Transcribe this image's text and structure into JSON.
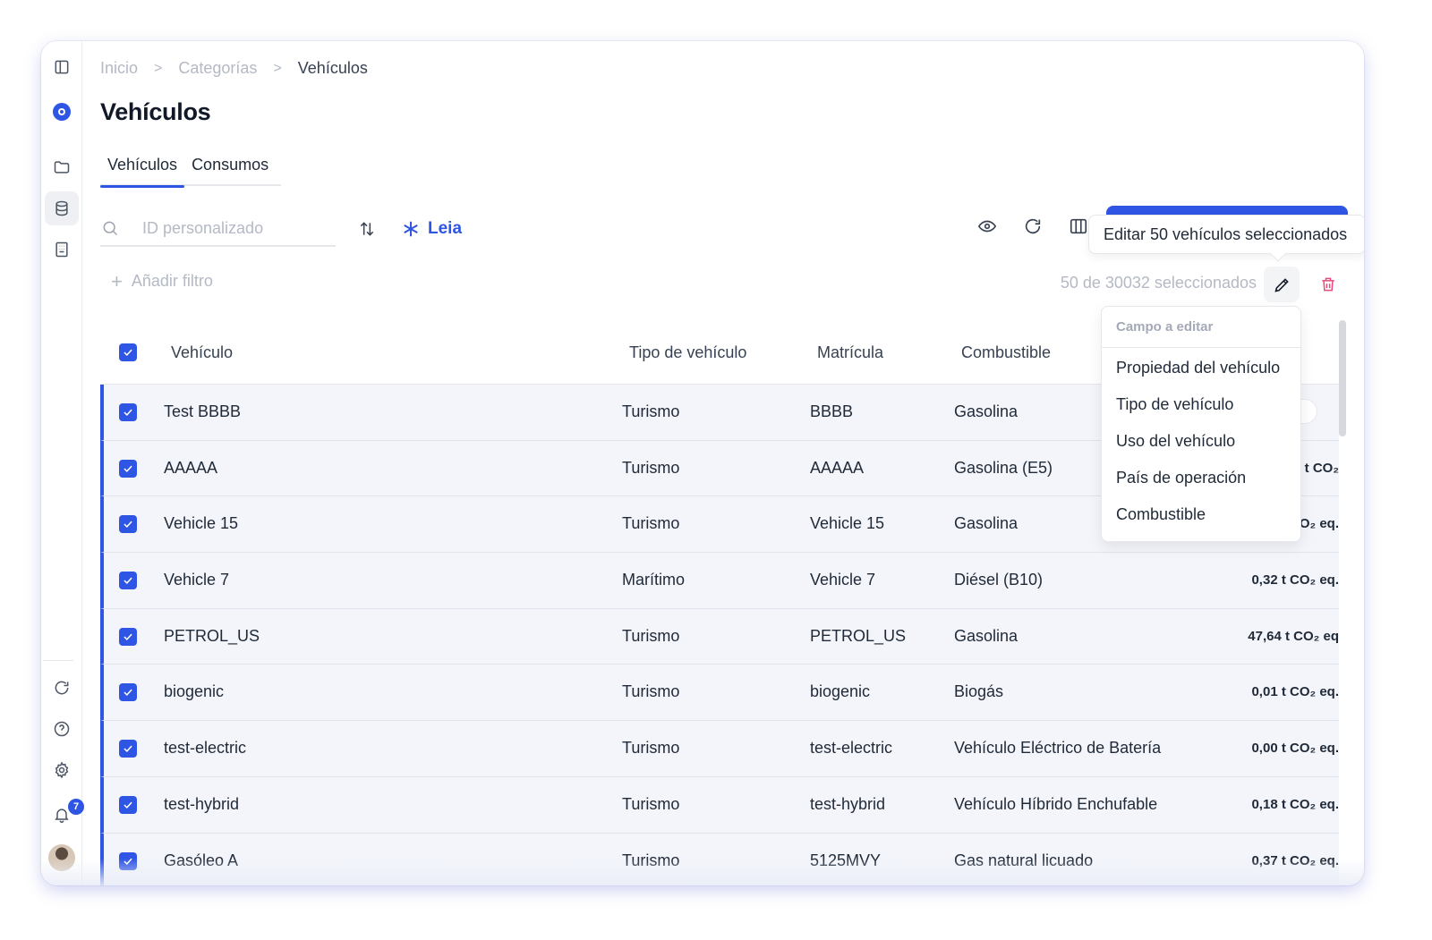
{
  "breadcrumb": {
    "home": "Inicio",
    "categories": "Categorías",
    "current": "Vehículos",
    "separator": ">"
  },
  "page_title": "Vehículos",
  "tabs": [
    {
      "label": "Vehículos",
      "active": true
    },
    {
      "label": "Consumos",
      "active": false
    }
  ],
  "search": {
    "placeholder": "ID personalizado"
  },
  "leia_label": "Leia",
  "tooltip": "Editar 50 vehículos seleccionados",
  "add_filter": "Añadir filtro",
  "selection_count": "50 de 30032 seleccionados",
  "notification_count": "7",
  "columns": {
    "vehicle": "Vehículo",
    "type": "Tipo de vehículo",
    "plate": "Matrícula",
    "fuel": "Combustible"
  },
  "dropdown": {
    "header": "Campo a editar",
    "items": [
      "Propiedad del vehículo",
      "Tipo de vehículo",
      "Uso del vehículo",
      "País de operación",
      "Combustible"
    ]
  },
  "rows": [
    {
      "vehicle": "Test BBBB",
      "type": "Turismo",
      "plate": "BBBB",
      "fuel": "Gasolina",
      "emissions": ""
    },
    {
      "vehicle": "AAAAA",
      "type": "Turismo",
      "plate": "AAAAA",
      "fuel": "Gasolina (E5)",
      "emissions": "t CO₂"
    },
    {
      "vehicle": "Vehicle 15",
      "type": "Turismo",
      "plate": "Vehicle 15",
      "fuel": "Gasolina",
      "emissions": "O₂ eq."
    },
    {
      "vehicle": "Vehicle 7",
      "type": "Marítimo",
      "plate": "Vehicle 7",
      "fuel": "Diésel (B10)",
      "emissions": "0,32 t CO₂ eq."
    },
    {
      "vehicle": "PETROL_US",
      "type": "Turismo",
      "plate": "PETROL_US",
      "fuel": "Gasolina",
      "emissions": "47,64 t CO₂ eq"
    },
    {
      "vehicle": "biogenic",
      "type": "Turismo",
      "plate": "biogenic",
      "fuel": "Biogás",
      "emissions": "0,01 t CO₂ eq."
    },
    {
      "vehicle": "test-electric",
      "type": "Turismo",
      "plate": "test-electric",
      "fuel": "Vehículo Eléctrico de Batería",
      "emissions": "0,00 t CO₂ eq."
    },
    {
      "vehicle": "test-hybrid",
      "type": "Turismo",
      "plate": "test-hybrid",
      "fuel": "Vehículo Híbrido Enchufable",
      "emissions": "0,18 t CO₂ eq."
    },
    {
      "vehicle": "Gasóleo A",
      "type": "Turismo",
      "plate": "5125MVY",
      "fuel": "Gas natural licuado",
      "emissions": "0,37 t CO₂ eq."
    }
  ],
  "colors": {
    "accent": "#2f55e4",
    "danger": "#e84b7a",
    "row_selected": "#f3f5fb"
  }
}
